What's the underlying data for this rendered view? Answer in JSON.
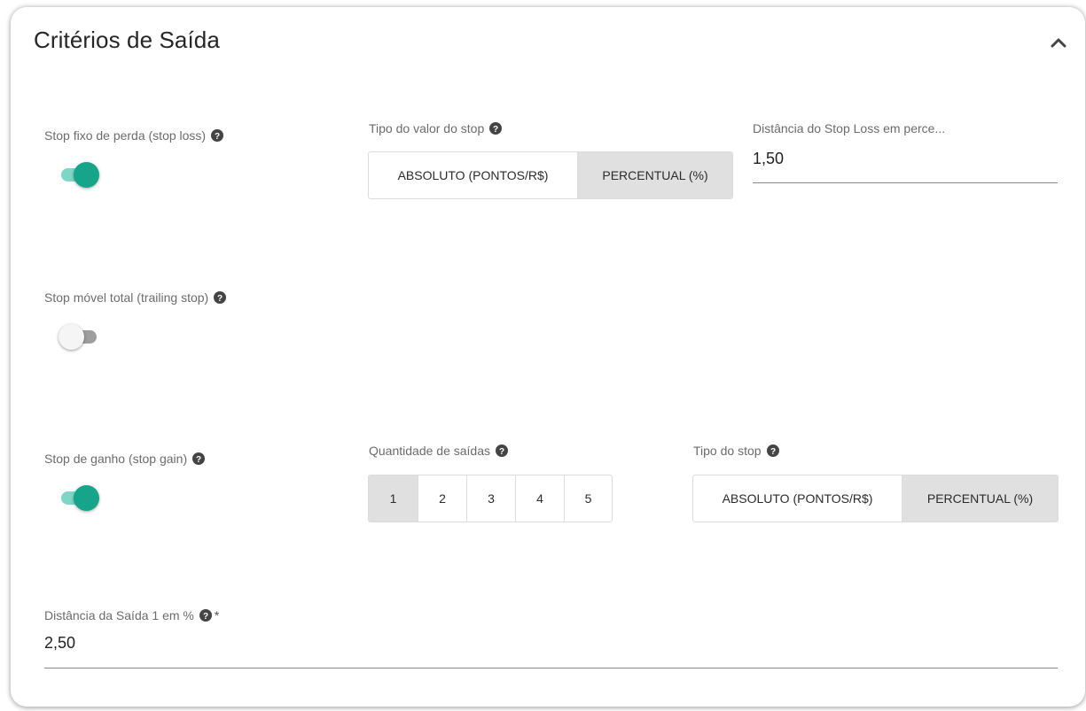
{
  "card": {
    "title": "Critérios de Saída",
    "collapse_icon": "chevron-up-icon"
  },
  "stop_loss": {
    "label": "Stop fixo de perda (stop loss)",
    "enabled": true,
    "value_type_label": "Tipo do valor do stop",
    "value_type_options": [
      "ABSOLUTO (PONTOS/R$)",
      "PERCENTUAL (%)"
    ],
    "value_type_selected": "PERCENTUAL (%)",
    "distance_label": "Distância do Stop Loss em perce...",
    "distance_value": "1,50"
  },
  "trailing_stop": {
    "label": "Stop móvel total (trailing stop)",
    "enabled": false
  },
  "stop_gain": {
    "label": "Stop de ganho (stop gain)",
    "enabled": true,
    "exits_label": "Quantidade de saídas",
    "exits_options": [
      "1",
      "2",
      "3",
      "4",
      "5"
    ],
    "exits_selected": "1",
    "stop_type_label": "Tipo do stop",
    "stop_type_options": [
      "ABSOLUTO (PONTOS/R$)",
      "PERCENTUAL (%)"
    ],
    "stop_type_selected": "PERCENTUAL (%)"
  },
  "exit1": {
    "label": "Distância da Saída 1 em %",
    "required_mark": "*",
    "value": "2,50"
  },
  "colors": {
    "toggle_on": "#16a58a",
    "toggle_on_track": "#7fd6c6",
    "selected_segment": "#e0e0e0"
  }
}
